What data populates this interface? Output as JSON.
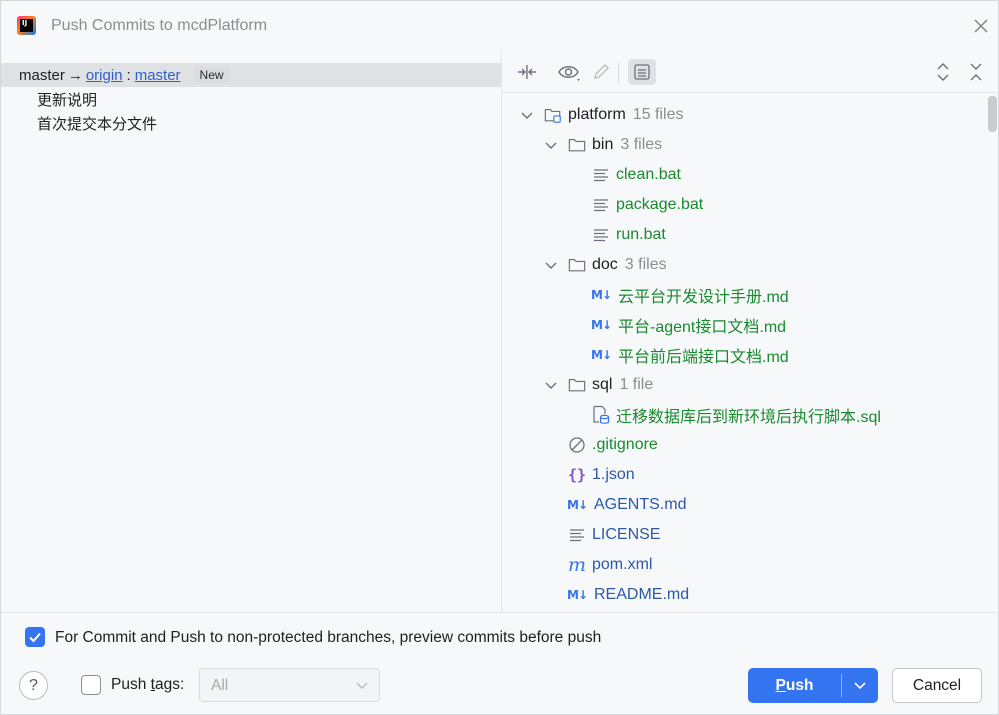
{
  "window": {
    "title": "Push Commits to mcdPlatform",
    "logo_icon": "intellij-idea-icon"
  },
  "left": {
    "branch": {
      "local": "master",
      "arrow": "→",
      "remote": "origin",
      "separator": ":",
      "remote_branch": "master",
      "badge": "New"
    },
    "commits": [
      "更新说明",
      "首次提交本分文件"
    ]
  },
  "toolbar": {
    "icons": [
      "collapse-arrows-icon",
      "eye-icon",
      "edit-pencil-icon",
      "show-diff-icon",
      "expand-all-icon",
      "collapse-all-icon"
    ]
  },
  "tree": {
    "root": {
      "name": "platform",
      "count": "15 files"
    },
    "folders": [
      {
        "name": "bin",
        "count": "3 files",
        "files": [
          "clean.bat",
          "package.bat",
          "run.bat"
        ]
      },
      {
        "name": "doc",
        "count": "3 files",
        "files": [
          "云平台开发设计手册.md",
          "平台-agent接口文档.md",
          "平台前后端接口文档.md"
        ]
      },
      {
        "name": "sql",
        "count": "1 file",
        "files": [
          "迁移数据库后到新环境后执行脚本.sql"
        ]
      }
    ],
    "root_files": [
      ".gitignore",
      "1.json",
      "AGENTS.md",
      "LICENSE",
      "pom.xml",
      "README.md"
    ]
  },
  "footer": {
    "preview_checkbox_label": "For Commit and Push to non-protected branches, preview commits before push",
    "preview_checked": true,
    "help_label": "?",
    "push_tags_prefix": "Push ",
    "push_tags_mnemonic": "t",
    "push_tags_suffix": "ags:",
    "push_tags_checked": false,
    "tags_select_value": "All",
    "push_button_mnemonic": "P",
    "push_button_rest": "ush",
    "cancel_button": "Cancel"
  },
  "colors": {
    "accent": "#3574f0",
    "added_file": "#198a2e",
    "modified_file": "#2b59a8",
    "selection": "#dfe1e5"
  }
}
